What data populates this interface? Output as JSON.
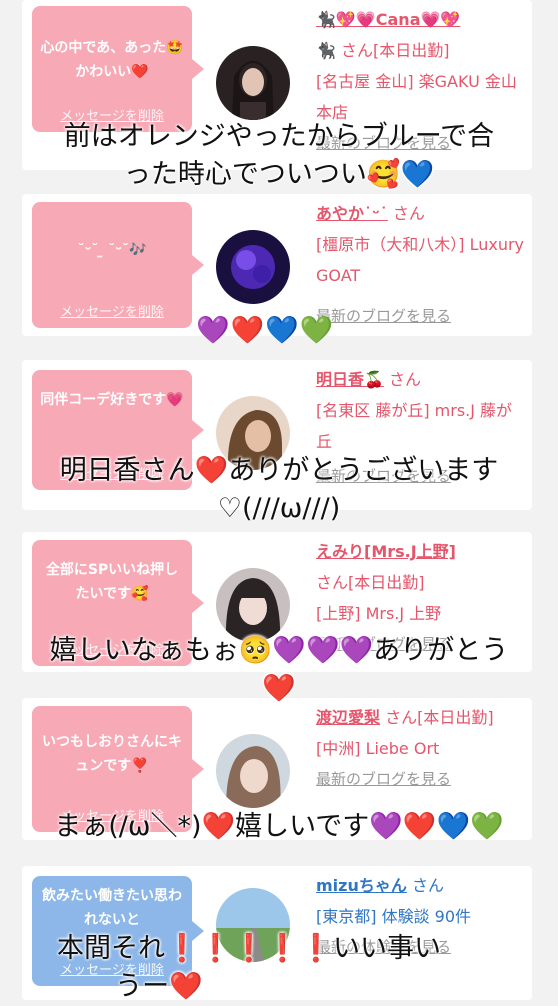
{
  "cards": [
    {
      "message": "心の中であ、あった🤩かわいい❤️",
      "delete_label": "メッセージを削除",
      "name": "🐈‍⬛💖💗Cana💗💖",
      "line2": "🐈‍⬛ さん[本日出勤]",
      "area": "[名古屋 金山] 楽GAKU 金山本店",
      "link": "最新のブログを見る"
    },
    {
      "message": "˘ᵕ˘ ̫ ˘ᵕ˘🎶",
      "delete_label": "メッセージを削除",
      "name": "あやか˙ᵕ˙",
      "line2": "さん",
      "area": "[橿原市（大和八木）] Luxury GOAT",
      "link": "最新のブログを見る"
    },
    {
      "message": "同伴コーデ好きです💗",
      "delete_label": "メッセージを削除",
      "name": "明日香🍒",
      "line2": "さん",
      "area": "[名東区 藤が丘] mrs.J 藤が丘",
      "link": "最新のブログを見る"
    },
    {
      "message": "全部にSPいいね押したいです🥰",
      "delete_label": "メッセージを削除",
      "name": "えみり[Mrs.J上野]",
      "line2": "さん[本日出勤]",
      "area": "[上野] Mrs.J 上野",
      "link": "最新のブログを見る"
    },
    {
      "message": "いつもしおりさんにキュンです❣️",
      "delete_label": "メッセージを削除",
      "name": "渡辺愛梨",
      "line2": "さん[本日出勤]",
      "area": "[中洲] Liebe Ort",
      "link": "最新のブログを見る"
    },
    {
      "message": "飲みたい働きたい思われないと",
      "delete_label": "メッセージを削除",
      "name": "mizuちゃん",
      "line2": "さん",
      "area": "[東京都] 体験談 90件",
      "link": "最新の体験談を見る"
    }
  ],
  "overlays": {
    "o1_line1": "前はオレンジやったからブルーで合",
    "o1_line2": "った時心でついつい🥰💙",
    "o2_hearts": "💜❤️💙💚",
    "o3_line1": "明日香さん❤️ありがとうございます",
    "o3_line2": "♡(///ω///)",
    "o4_line1": "嬉しいなぁもぉ🥺💜💜💜ありがとう",
    "o4_line2": "❤️",
    "o5_line1": "まぁ(/ω＼*)❤️嬉しいです💜❤️💙💚",
    "o6_line1": "本間それ❗️❗️❗️❗️❗️いい事い",
    "o6_line2": "うー❤️"
  },
  "colors": {
    "accent_pink": "#e4566b",
    "bubble_pink": "#f7a9b6",
    "bubble_blue": "#8cb7e8",
    "link_blue": "#2f76c4"
  }
}
